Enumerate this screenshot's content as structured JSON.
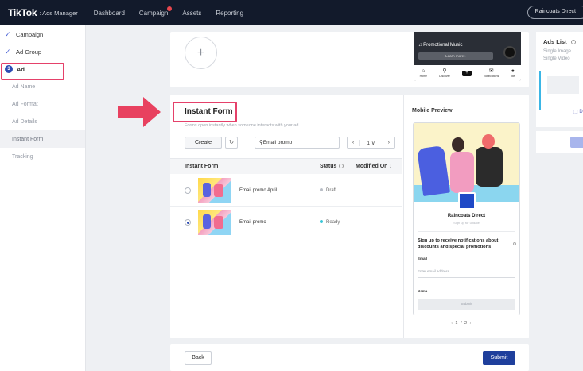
{
  "topbar": {
    "logo": "TikTok",
    "logo_sub": ": Ads Manager",
    "nav": [
      "Dashboard",
      "Campaign",
      "Assets",
      "Reporting"
    ],
    "account": "Raincoats Direct"
  },
  "sidebar": {
    "campaign": "Campaign",
    "ad_group": "Ad Group",
    "ad_step_num": "3",
    "ad": "Ad",
    "sub_items": [
      "Ad Name",
      "Ad Format",
      "Ad Details",
      "Instant Form",
      "Tracking"
    ]
  },
  "preview_top": {
    "add_symbol": "+",
    "music": "♫ Promotional Music",
    "learn_more": "Learn more ›",
    "tabs": [
      "Home",
      "Discover",
      "+",
      "Notifications",
      "Me"
    ]
  },
  "form": {
    "title": "Instant Form",
    "desc": "Forms open instantly when someone interacts with your ad.",
    "create": "Create",
    "refresh_symbol": "↻",
    "search_value": "Email promo",
    "pager_prev": "‹",
    "pager_page": "1  ∨",
    "pager_next": "›",
    "columns": {
      "name": "Instant Form",
      "status": "Status",
      "modified": "Modified On ↓"
    },
    "rows": [
      {
        "name": "Email promo April",
        "status": "Draft",
        "status_color": "#b9bec6",
        "selected": false
      },
      {
        "name": "Email promo",
        "status": "Ready",
        "status_color": "#3ac6d8",
        "selected": true
      }
    ]
  },
  "mobile_preview": {
    "title": "Mobile Preview",
    "brand": "Raincoats Direct",
    "brand_sub": "Sign up for update",
    "headline": "Sign up to receive notifications about discounts and special promotions",
    "email_label": "Email",
    "email_placeholder": "Enter email address",
    "name_label": "Name",
    "submit": "Submit",
    "pager": "‹   1 / 2   ›"
  },
  "actions": {
    "back": "Back",
    "submit": "Submit"
  },
  "ads_list": {
    "title": "Ads List",
    "types": [
      "Single Image",
      "Single Video"
    ],
    "delete": "⬚ D"
  },
  "colors": {
    "accent": "#1f3f9c",
    "highlight": "#e5416a",
    "topbar": "#121a2b",
    "arrow": "#e8415f"
  }
}
